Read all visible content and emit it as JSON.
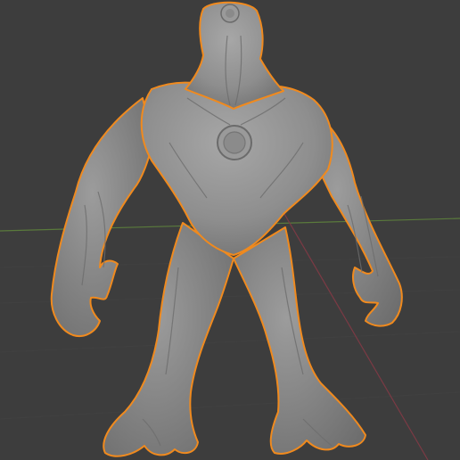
{
  "viewport": {
    "background": "#3d3d3d",
    "grid_line_color": "#464646",
    "x_axis_color": "#7b3a44",
    "y_axis_color": "#5a7a3c"
  },
  "selected_object": {
    "outline_color": "#f08a1e",
    "mesh_color": "#8f8f8f",
    "shading": "sculpt-gray",
    "state": "selected"
  }
}
